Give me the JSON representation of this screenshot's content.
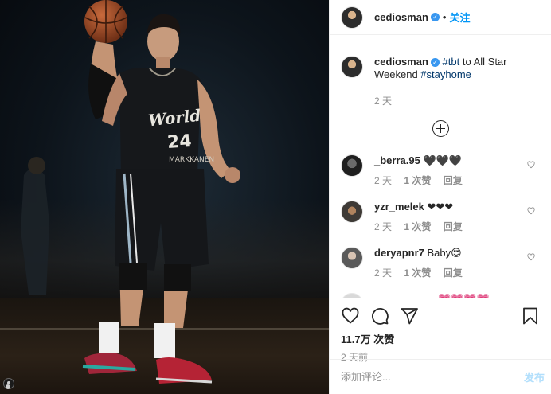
{
  "post": {
    "username": "cediosman",
    "follow_label": "关注",
    "dot": "•",
    "verified_mark": "✓"
  },
  "caption": {
    "username": "cediosman",
    "tag1": "#tbt",
    "text": " to All Star Weekend ",
    "tag2": "#stayhome",
    "time": "2 天"
  },
  "comments": [
    {
      "username": "_berra.95",
      "text": "🖤🖤🖤",
      "time": "2 天",
      "likes": "1 次赞",
      "reply": "回复"
    },
    {
      "username": "yzr_melek",
      "text": "❤❤❤",
      "time": "2 天",
      "likes": "1 次赞",
      "reply": "回复"
    },
    {
      "username": "deryapnr7",
      "text": "Baby😍",
      "time": "2 天",
      "likes": "1 次赞",
      "reply": "回复"
    },
    {
      "username": "",
      "text": "💗💗💗💗",
      "time": "",
      "likes": "",
      "reply": ""
    }
  ],
  "stats": {
    "likes": "11.7万 次赞",
    "posted": "2 天前"
  },
  "comment_box": {
    "placeholder": "添加评论...",
    "post_label": "发布"
  },
  "icons": {
    "like": "heart-icon",
    "comment": "comment-icon",
    "share": "share-icon",
    "save": "bookmark-icon",
    "load_more": "plus-circle-icon"
  },
  "colors": {
    "link_blue": "#0095f6",
    "hashtag": "#00376b",
    "muted": "#8e8e8e",
    "post_disabled": "#b2dffc"
  },
  "photo": {
    "jersey_text": "World",
    "jersey_number": "24",
    "jersey_name": "MARKKANEN"
  }
}
